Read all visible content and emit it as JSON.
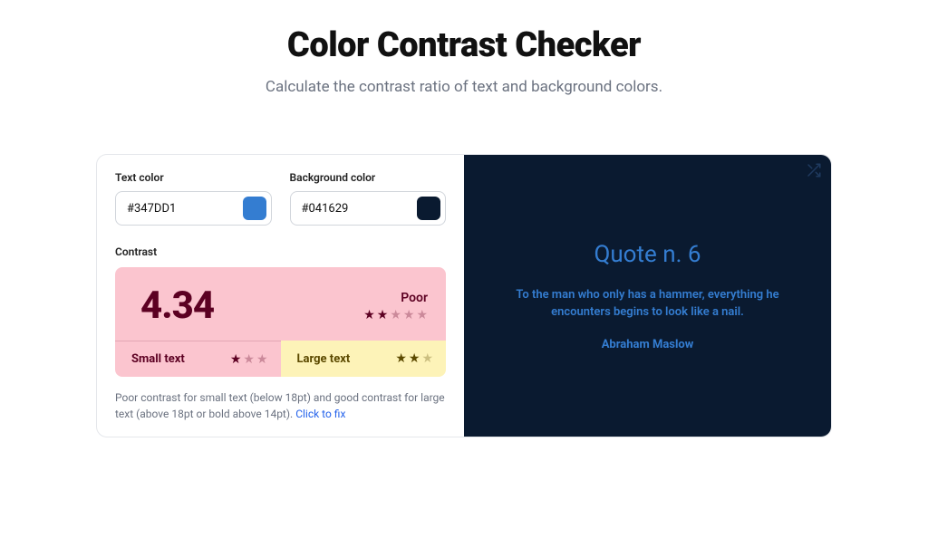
{
  "header": {
    "title": "Color Contrast Checker",
    "subtitle": "Calculate the contrast ratio of text and background colors."
  },
  "colors": {
    "text": {
      "label": "Text color",
      "value": "#347DD1",
      "swatch": "#347DD1"
    },
    "background": {
      "label": "Background color",
      "value": "#041629",
      "swatch": "#0a1a30"
    }
  },
  "contrast": {
    "label": "Contrast",
    "ratio": "4.34",
    "rating_text": "Poor",
    "stars_filled": 2,
    "stars_total": 5,
    "small": {
      "label": "Small text",
      "stars_filled": 1,
      "stars_total": 3
    },
    "large": {
      "label": "Large text",
      "stars_filled": 2,
      "stars_total": 3
    },
    "hint_text": "Poor contrast for small text (below 18pt) and good contrast for large text (above 18pt or bold above 14pt). ",
    "hint_link": "Click to fix"
  },
  "preview": {
    "title": "Quote n. 6",
    "body": "To the man who only has a hammer, everything he encounters begins to look like a nail.",
    "author": "Abraham Maslow",
    "text_color": "#347DD1",
    "bg_color": "#0a1a30"
  },
  "icons": {
    "shuffle": "shuffle-icon"
  }
}
